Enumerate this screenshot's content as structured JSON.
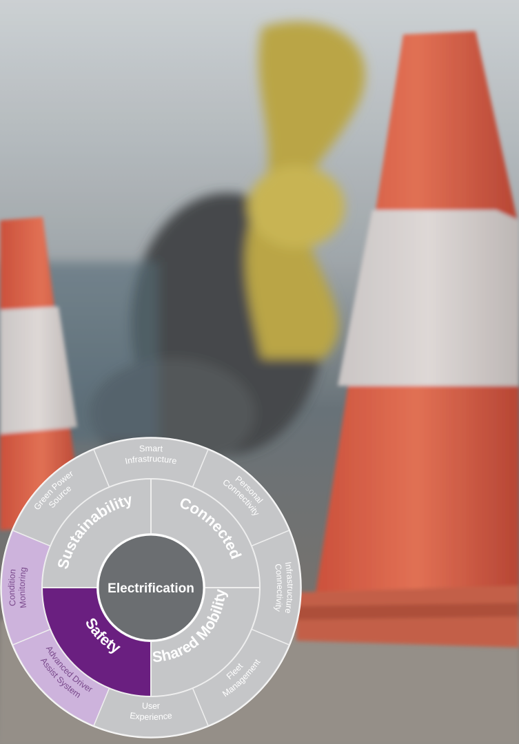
{
  "diagram": {
    "center": {
      "label": "Electrification"
    },
    "inner_ring": [
      {
        "id": "sustainability",
        "label": "Sustainability",
        "highlight": false
      },
      {
        "id": "connected",
        "label": "Connected",
        "highlight": false
      },
      {
        "id": "shared-mobility",
        "label": "Shared Mobility",
        "highlight": false
      },
      {
        "id": "safety",
        "label": "Safety",
        "highlight": true
      }
    ],
    "outer_ring": [
      {
        "id": "smart-infrastructure",
        "lines": [
          "Smart",
          "Infrastructure"
        ],
        "highlight": false
      },
      {
        "id": "personal-connectivity",
        "lines": [
          "Personal",
          "Connectivity"
        ],
        "highlight": false
      },
      {
        "id": "infrastructure-connectivity",
        "lines": [
          "Infrastructure",
          "Connectivity"
        ],
        "highlight": false
      },
      {
        "id": "fleet-management",
        "lines": [
          "Fleet",
          "Management"
        ],
        "highlight": false
      },
      {
        "id": "user-experience",
        "lines": [
          "User",
          "Experience"
        ],
        "highlight": false
      },
      {
        "id": "advanced-driver-assist-system",
        "lines": [
          "Advanced Driver",
          "Assist System"
        ],
        "highlight": true
      },
      {
        "id": "condition-monitoring",
        "lines": [
          "Condition",
          "Monitoring"
        ],
        "highlight": true
      },
      {
        "id": "green-power-source",
        "lines": [
          "Green Power",
          "Source"
        ],
        "highlight": false
      }
    ],
    "colors": {
      "ring": "#c5c6c8",
      "center": "#6b6e71",
      "highlight_inner": "#6a1f80",
      "highlight_outer": "#cdb3dc",
      "divider": "#eeeeee",
      "inner_text": "#ffffff",
      "outer_text": "#ffffff",
      "outer_text_highlight": "#7a4a8c"
    }
  }
}
